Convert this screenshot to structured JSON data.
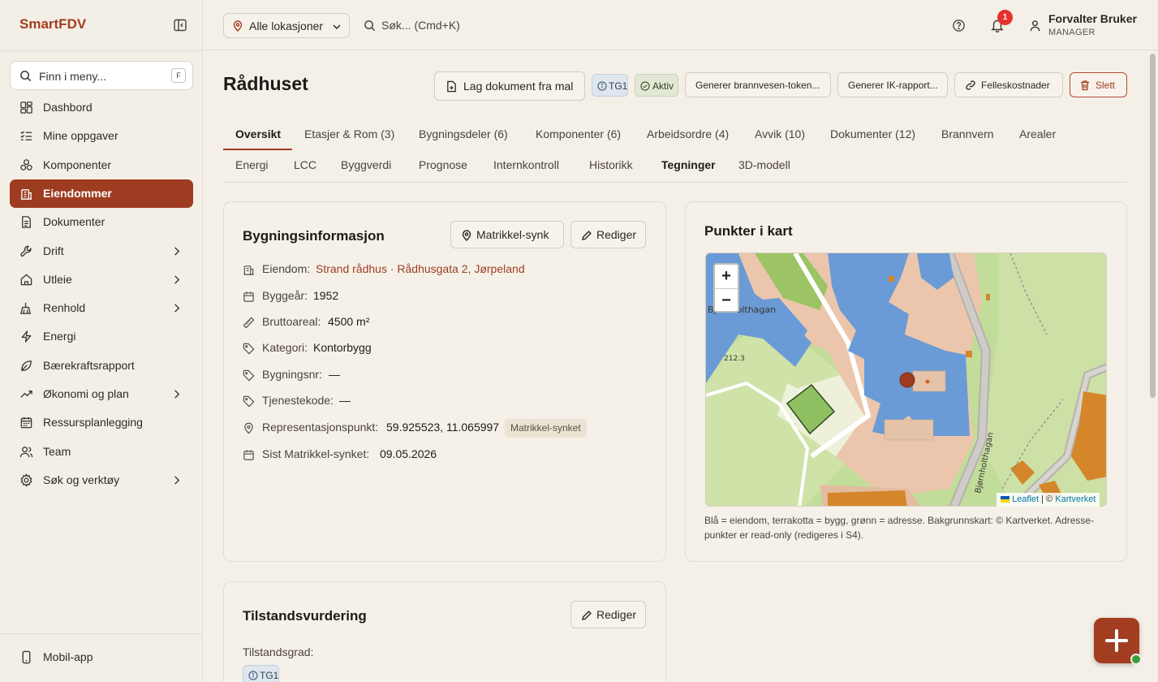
{
  "brand": "SmartFDV",
  "menu_search": {
    "placeholder": "Finn i meny...",
    "shortcut": "F"
  },
  "sidebar": {
    "items": [
      {
        "label": "Dashbord",
        "icon": "dashboard-icon"
      },
      {
        "label": "Mine oppgaver",
        "icon": "checklist-icon"
      },
      {
        "label": "Komponenter",
        "icon": "components-icon"
      },
      {
        "label": "Eiendommer",
        "icon": "building-icon",
        "active": true
      },
      {
        "label": "Dokumenter",
        "icon": "document-icon"
      },
      {
        "label": "Drift",
        "icon": "wrench-icon",
        "expandable": true
      },
      {
        "label": "Utleie",
        "icon": "home-icon",
        "expandable": true
      },
      {
        "label": "Renhold",
        "icon": "broom-icon",
        "expandable": true
      },
      {
        "label": "Energi",
        "icon": "lightning-icon"
      },
      {
        "label": "Bærekraftsrapport",
        "icon": "leaf-icon"
      },
      {
        "label": "Økonomi og plan",
        "icon": "trend-icon",
        "expandable": true
      },
      {
        "label": "Ressursplanlegging",
        "icon": "calendar-icon"
      },
      {
        "label": "Team",
        "icon": "team-icon"
      },
      {
        "label": "Søk og verktøy",
        "icon": "settings-icon",
        "expandable": true
      }
    ],
    "bottom": {
      "label": "Mobil-app",
      "icon": "mobile-icon"
    }
  },
  "topbar": {
    "location": "Alle lokasjoner",
    "search_placeholder": "Søk... (Cmd+K)",
    "notifications": "1",
    "user_name": "Forvalter Bruker",
    "user_role": "MANAGER"
  },
  "page": {
    "title": "Rådhuset",
    "actions": {
      "make_doc": "Lag dokument fra mal",
      "tag_tg": "TG1",
      "tag_status": "Aktiv",
      "fire_token": "Generer brannvesen-token...",
      "ik_report": "Generer IK-rapport...",
      "shared_costs": "Felleskostnader",
      "delete": "Slett"
    },
    "tabs_row1": [
      "Oversikt",
      "Etasjer & Rom (3)",
      "Bygningsdeler (6)",
      "Komponenter (6)",
      "Arbeidsordre (4)",
      "Avvik (10)",
      "Dokumenter (12)",
      "Brannvern",
      "Arealer"
    ],
    "tabs_row2": [
      "Energi",
      "LCC",
      "Byggverdi",
      "Prognose",
      "Internkontroll",
      "Historikk",
      "Tegninger",
      "3D-modell"
    ]
  },
  "building_info": {
    "title": "Bygningsinformasjon",
    "sync_button": "Matrikkel-synk",
    "edit_button": "Rediger",
    "rows": {
      "eiendom": {
        "label": "Eiendom:",
        "value": "Strand rådhus · Rådhusgata 2, Jørpeland"
      },
      "byggear": {
        "label": "Byggeår:",
        "value": "1952"
      },
      "areal": {
        "label": "Bruttoareal:",
        "value": "4500 m²"
      },
      "kategori": {
        "label": "Kategori:",
        "value": "Kontorbygg"
      },
      "bygningsnr": {
        "label": "Bygningsnr:",
        "value": "—"
      },
      "tjeneste": {
        "label": "Tjenestekode:",
        "value": "—"
      },
      "punkt": {
        "label": "Representasjonspunkt:",
        "value": "59.925523, 11.065997",
        "badge": "Matrikkel-synket"
      },
      "synket": {
        "label": "Sist Matrikkel-synket:",
        "value": "09.05.2026"
      }
    }
  },
  "map_card": {
    "title": "Punkter i kart",
    "zoom_in": "+",
    "zoom_out": "−",
    "label_road_top": "Bjørnholthagan",
    "label_road_right": "Bjørnholthagan",
    "label_height": "212.3",
    "attr_leaflet": "Leaflet",
    "attr_sep": "| ©",
    "attr_kartverket": "Kartverket",
    "caption": "Blå = eiendom, terrakotta = bygg, grønn = adresse. Bakgrunnskart: © Kartverket. Adresse-punkter er read-only (redigeres i S4)."
  },
  "condition": {
    "title": "Tilstandsvurdering",
    "edit_button": "Rediger",
    "label": "Tilstandsgrad:",
    "grade": "TG1"
  },
  "colors": {
    "accent": "#a23d22",
    "property_blue": "#6b9bd6",
    "building_terracotta": "#e9b89a",
    "address_green": "#8fc062"
  }
}
